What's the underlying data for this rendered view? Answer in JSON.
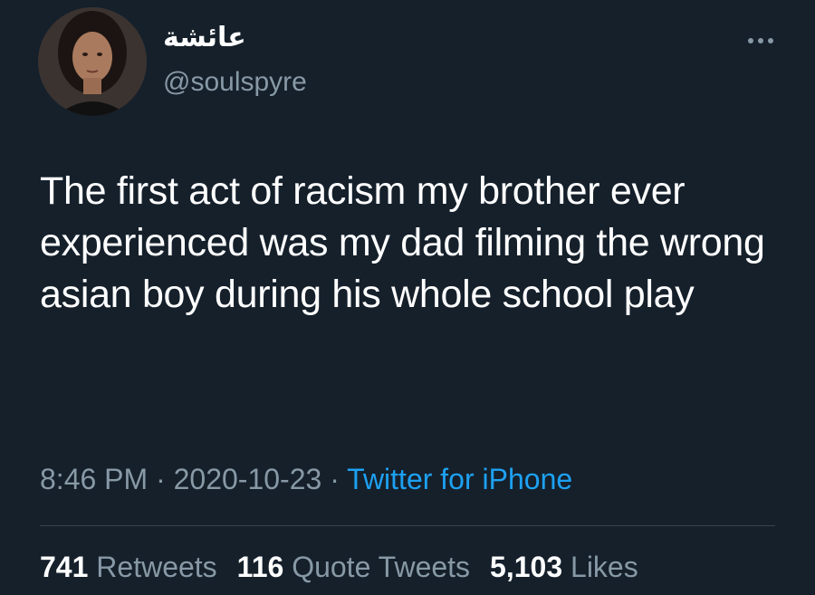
{
  "author": {
    "display_name": "عائشة",
    "handle": "@soulspyre",
    "avatar_icon": "profile-photo"
  },
  "menu_icon": "more-options-icon",
  "tweet": {
    "text": "The first act of racism my brother ever experienced was my dad filming the wrong asian boy during his whole school play",
    "time": "8:46 PM",
    "date": "2020-10-23",
    "separator": "·",
    "source": "Twitter for iPhone"
  },
  "stats": {
    "retweets": {
      "count": "741",
      "label": "Retweets"
    },
    "quote_tweets": {
      "count": "116",
      "label": "Quote Tweets"
    },
    "likes": {
      "count": "5,103",
      "label": "Likes"
    }
  },
  "colors": {
    "background": "#15202b",
    "primary_text": "#ffffff",
    "secondary_text": "#8899a6",
    "link": "#1da1f2",
    "divider": "#38444d"
  }
}
